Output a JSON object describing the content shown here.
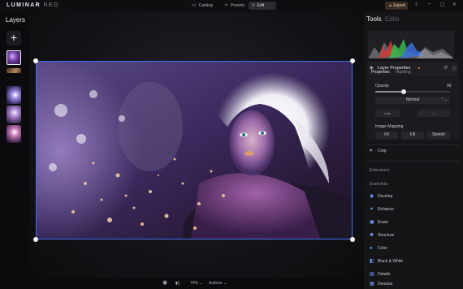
{
  "app": {
    "brand": "LUMINAR",
    "brand_suffix": "NEO"
  },
  "topbar": {
    "catalog": "Catalog",
    "presets": "Presets",
    "edit": "Edit",
    "export": "Export"
  },
  "layers": {
    "title": "Layers",
    "add": "+"
  },
  "bottombar": {
    "zoom": "74%",
    "actions": "Actions"
  },
  "tools_panel": {
    "tab_tools": "Tools",
    "tab_edits": "Edits",
    "layer_properties": "Layer Properties",
    "subtab_properties": "Properties",
    "subtab_masking": "Masking",
    "opacity_label": "Opacity",
    "opacity_value": "99",
    "opacity_fraction": 0.38,
    "blend_mode": "Normal",
    "pill_left": "lock",
    "pill_right": "|",
    "image_mapping_label": "Image Mapping",
    "mapping_fit": "Fit",
    "mapping_fill": "Fill",
    "mapping_stretch": "Stretch",
    "crop": "Crop",
    "extensions": "Extensions",
    "essentials": "Essentials",
    "tools": [
      "Develop",
      "Enhance",
      "Erase",
      "Structure",
      "Color",
      "Black & White",
      "Details",
      "Denoise"
    ]
  },
  "colors": {
    "accent": "#3d6ef0",
    "tool_icon": "#6fa3ff",
    "panel_bg": "#151518"
  }
}
